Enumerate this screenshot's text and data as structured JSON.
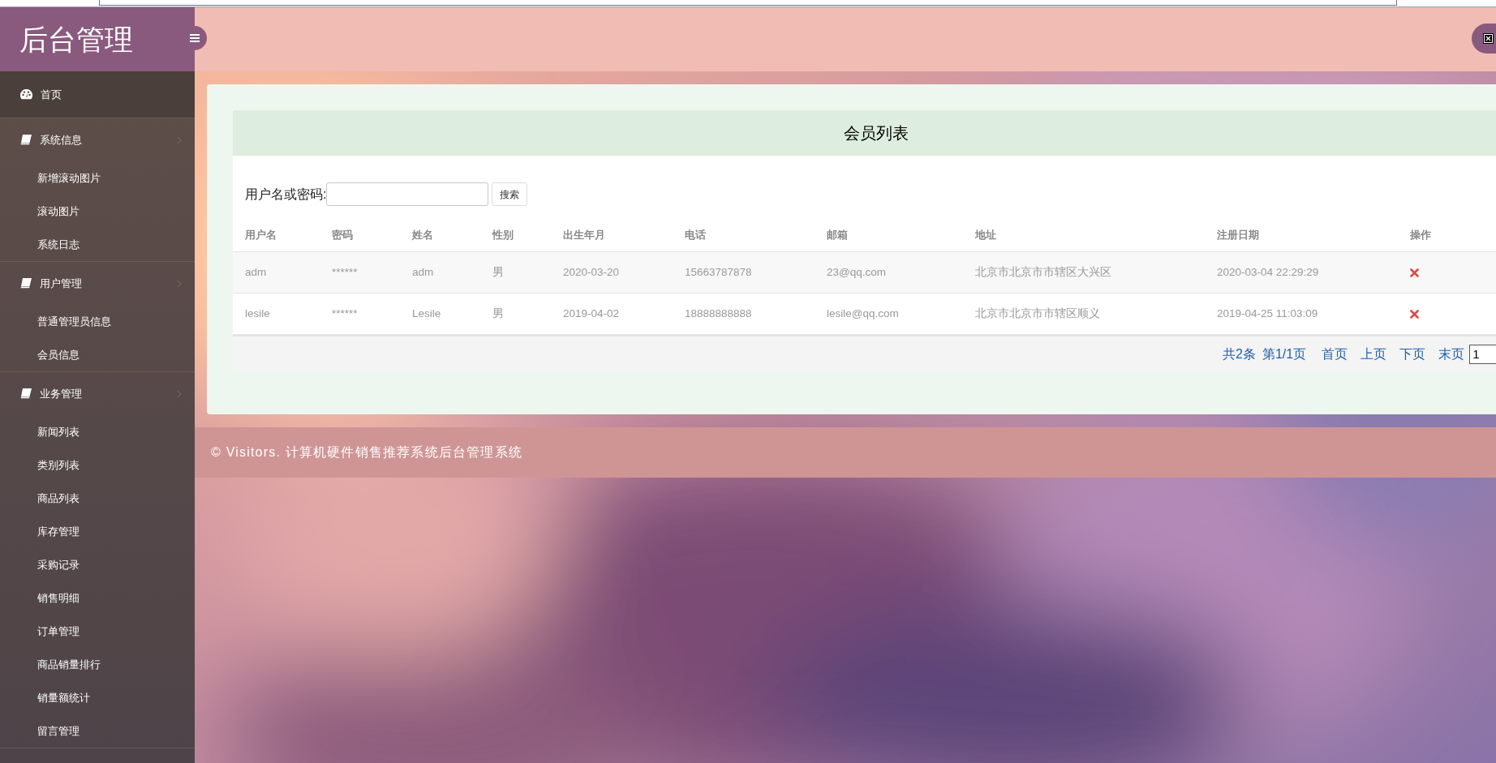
{
  "sidebar": {
    "title": "后台管理",
    "menu": [
      {
        "label": "首页",
        "kind": "link",
        "selected": true
      },
      {
        "label": "系统信息",
        "kind": "group",
        "selected": false,
        "children": [
          {
            "label": "新增滚动图片"
          },
          {
            "label": "滚动图片"
          },
          {
            "label": "系统日志"
          }
        ]
      },
      {
        "label": "用户管理",
        "kind": "group",
        "selected": false,
        "children": [
          {
            "label": "普通管理员信息"
          },
          {
            "label": "会员信息"
          }
        ]
      },
      {
        "label": "业务管理",
        "kind": "group",
        "selected": false,
        "children": [
          {
            "label": "新闻列表"
          },
          {
            "label": "类别列表"
          },
          {
            "label": "商品列表"
          },
          {
            "label": "库存管理"
          },
          {
            "label": "采购记录"
          },
          {
            "label": "销售明细"
          },
          {
            "label": "订单管理"
          },
          {
            "label": "商品销量排行"
          },
          {
            "label": "销量额统计"
          },
          {
            "label": "留言管理"
          }
        ]
      }
    ]
  },
  "panel": {
    "title": "会员列表",
    "search": {
      "label": "用户名或密码:",
      "button": "搜索"
    },
    "table": {
      "columns": [
        "用户名",
        "密码",
        "姓名",
        "性别",
        "出生年月",
        "电话",
        "邮箱",
        "地址",
        "注册日期",
        "操作"
      ],
      "rows": [
        {
          "cells": [
            "adm",
            "******",
            "adm",
            "男",
            "2020-03-20",
            "15663787878",
            "23@qq.com",
            "北京市北京市市辖区大兴区",
            "2020-03-04 22:29:29"
          ]
        },
        {
          "cells": [
            "lesile",
            "******",
            "Lesile",
            "男",
            "2019-04-02",
            "18888888888",
            "lesile@qq.com",
            "北京市北京市市辖区顺义",
            "2019-04-25 11:03:09"
          ]
        }
      ]
    },
    "pagination": {
      "summary": [
        "共2条",
        "第1/1页"
      ],
      "links": [
        "首页",
        "上页",
        "下页",
        "末页"
      ],
      "page": "1"
    }
  },
  "footer": {
    "text": "© Visitors. 计算机硬件销售推荐系统后台管理系统"
  }
}
